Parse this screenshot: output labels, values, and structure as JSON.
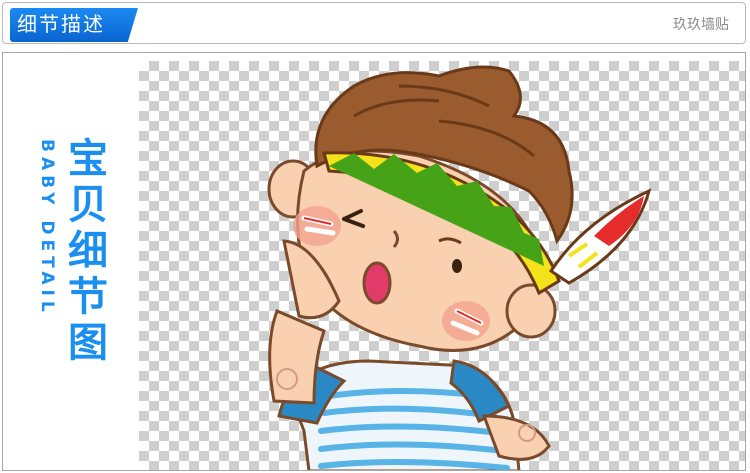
{
  "header": {
    "title": "细节描述",
    "shop_name": "玖玖墙贴"
  },
  "side_label": {
    "chinese": "宝贝细节图",
    "english": "BABY DETAIL"
  },
  "image": {
    "icon": "cartoon-boy-with-feather-headband",
    "colors": {
      "accent": "#1a8ff0",
      "hair": "#9a5b2e",
      "skin": "#f9d1b1",
      "headband_yellow": "#f4e21a",
      "headband_green": "#46a317",
      "shirt_blue": "#2a89c4"
    }
  }
}
